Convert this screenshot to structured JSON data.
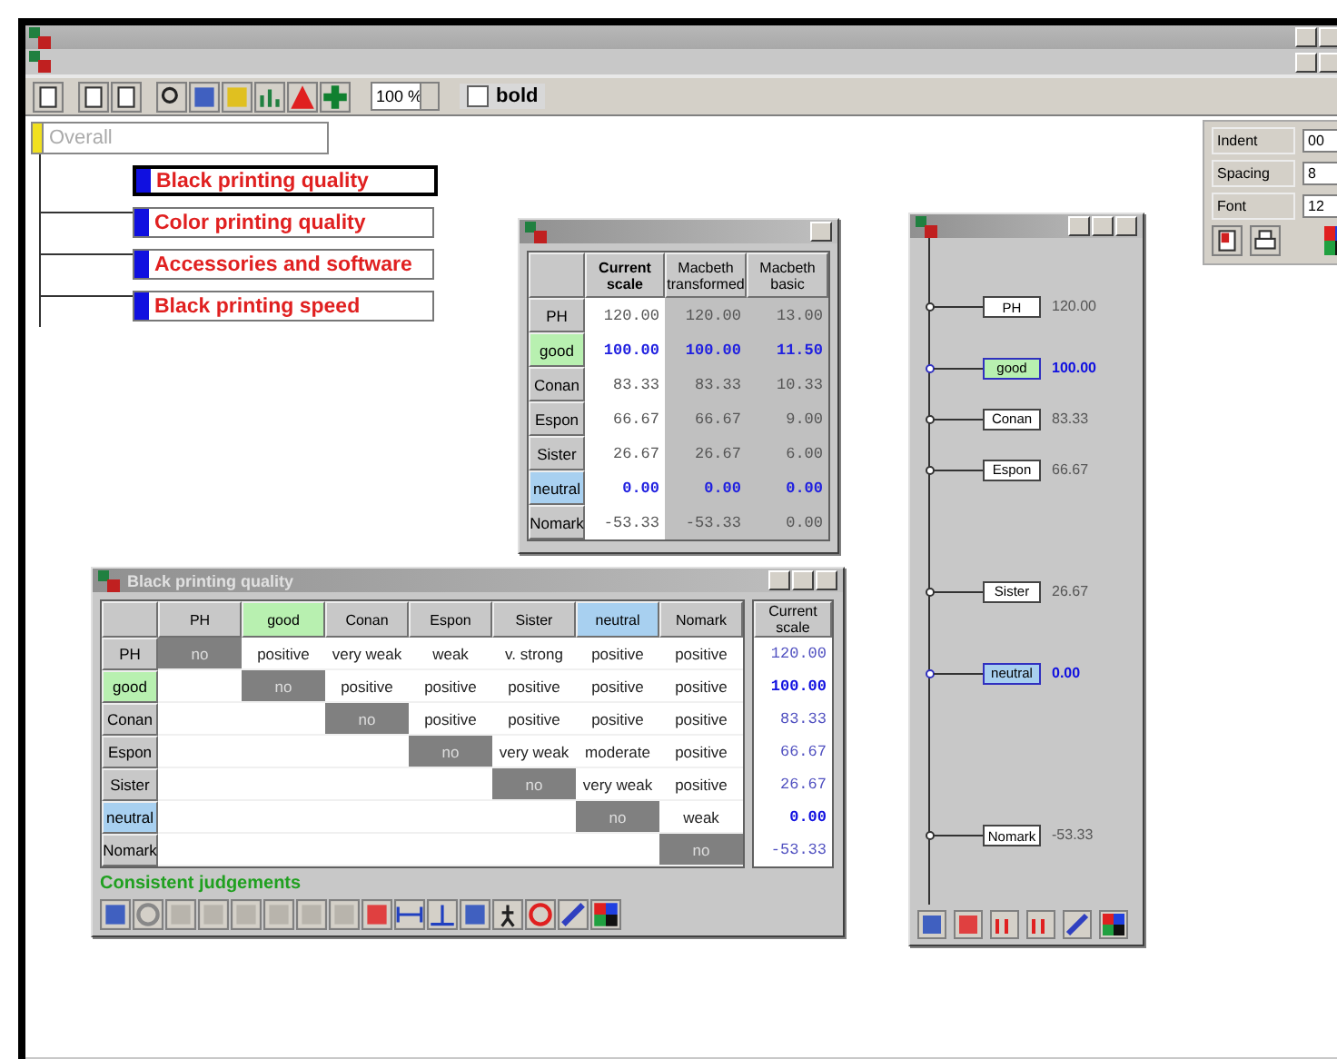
{
  "toolbar": {
    "zoom": "100 %",
    "bold": {
      "label": "bold",
      "checked": false
    }
  },
  "format_panel": {
    "fields": [
      {
        "label": "Indent",
        "value": "00"
      },
      {
        "label": "Spacing",
        "value": "8"
      },
      {
        "label": "Font",
        "value": "12"
      }
    ]
  },
  "tree": {
    "root": "Overall",
    "children": [
      {
        "label": "Black printing quality",
        "selected": true
      },
      {
        "label": "Color printing quality",
        "selected": false
      },
      {
        "label": "Accessories and software",
        "selected": false
      },
      {
        "label": "Black printing speed",
        "selected": false
      }
    ]
  },
  "scale_window": {
    "columns": [
      "Current scale",
      "Macbeth transformed",
      "Macbeth basic"
    ],
    "rows": [
      {
        "label": "PH",
        "kind": "option",
        "values": [
          "120.00",
          "120.00",
          "13.00"
        ]
      },
      {
        "label": "good",
        "kind": "good",
        "values": [
          "100.00",
          "100.00",
          "11.50"
        ]
      },
      {
        "label": "Conan",
        "kind": "option",
        "values": [
          "83.33",
          "83.33",
          "10.33"
        ]
      },
      {
        "label": "Espon",
        "kind": "option",
        "values": [
          "66.67",
          "66.67",
          "9.00"
        ]
      },
      {
        "label": "Sister",
        "kind": "option",
        "values": [
          "26.67",
          "26.67",
          "6.00"
        ]
      },
      {
        "label": "neutral",
        "kind": "neutral",
        "values": [
          "0.00",
          "0.00",
          "0.00"
        ]
      },
      {
        "label": "Nomark",
        "kind": "option",
        "values": [
          "-53.33",
          "-53.33",
          "0.00"
        ]
      }
    ]
  },
  "matrix_window": {
    "title": "Black printing quality",
    "columns": [
      {
        "label": "PH",
        "kind": "option"
      },
      {
        "label": "good",
        "kind": "good"
      },
      {
        "label": "Conan",
        "kind": "option"
      },
      {
        "label": "Espon",
        "kind": "option"
      },
      {
        "label": "Sister",
        "kind": "option"
      },
      {
        "label": "neutral",
        "kind": "neutral"
      },
      {
        "label": "Nomark",
        "kind": "option"
      }
    ],
    "scale_heading": "Current scale",
    "rows": [
      {
        "label": "PH",
        "kind": "option",
        "judgements": [
          "no",
          "positive",
          "very weak",
          "weak",
          "v. strong",
          "positive",
          "positive"
        ],
        "scale": "120.00"
      },
      {
        "label": "good",
        "kind": "good",
        "judgements": [
          "no",
          "positive",
          "positive",
          "positive",
          "positive",
          "positive"
        ],
        "scale": "100.00"
      },
      {
        "label": "Conan",
        "kind": "option",
        "judgements": [
          "no",
          "positive",
          "positive",
          "positive",
          "positive"
        ],
        "scale": "83.33"
      },
      {
        "label": "Espon",
        "kind": "option",
        "judgements": [
          "no",
          "very weak",
          "moderate",
          "positive"
        ],
        "scale": "66.67"
      },
      {
        "label": "Sister",
        "kind": "option",
        "judgements": [
          "no",
          "very weak",
          "positive"
        ],
        "scale": "26.67"
      },
      {
        "label": "neutral",
        "kind": "neutral",
        "judgements": [
          "no",
          "weak"
        ],
        "scale": "0.00"
      },
      {
        "label": "Nomark",
        "kind": "option",
        "judgements": [
          "no"
        ],
        "scale": "-53.33"
      }
    ],
    "status": "Consistent judgements"
  },
  "ruler_window": {
    "items": [
      {
        "label": "PH",
        "kind": "option",
        "value": "120.00"
      },
      {
        "label": "good",
        "kind": "good",
        "value": "100.00"
      },
      {
        "label": "Conan",
        "kind": "option",
        "value": "83.33"
      },
      {
        "label": "Espon",
        "kind": "option",
        "value": "66.67"
      },
      {
        "label": "Sister",
        "kind": "option",
        "value": "26.67"
      },
      {
        "label": "neutral",
        "kind": "neutral",
        "value": "0.00"
      },
      {
        "label": "Nomark",
        "kind": "option",
        "value": "-53.33"
      }
    ]
  }
}
